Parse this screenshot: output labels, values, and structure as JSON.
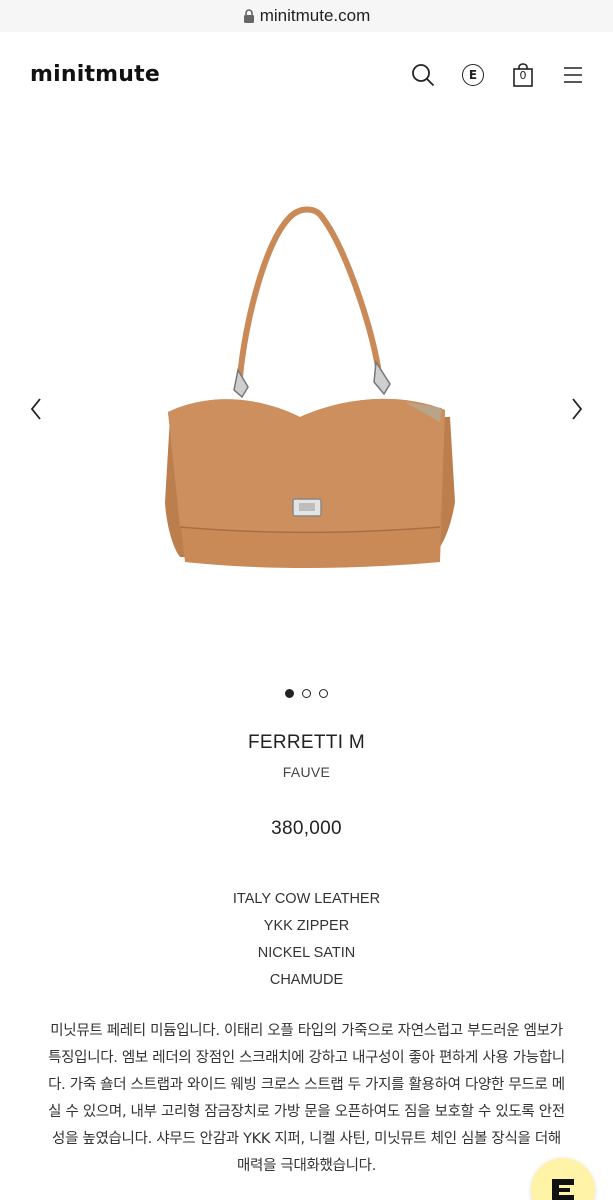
{
  "browser": {
    "url": "minitmute.com"
  },
  "header": {
    "logo": "minitmute",
    "e_badge": "E",
    "cart_count": "0"
  },
  "icons": [
    "lock-icon",
    "search-icon",
    "e-point-icon",
    "shopping-bag-icon",
    "hamburger-menu-icon",
    "chevron-left-icon",
    "chevron-right-icon",
    "chat-icon"
  ],
  "carousel": {
    "slides": 3,
    "active_index": 0
  },
  "product": {
    "name": "FERRETTI M",
    "color": "FAUVE",
    "price": "380,000",
    "specs": [
      "ITALY COW LEATHER",
      "YKK ZIPPER",
      "NICKEL SATIN",
      "CHAMUDE"
    ],
    "description": "미닛뮤트 페레티 미듐입니다. 이태리 오플 타입의 가죽으로 자연스럽고 부드러운 엠보가 특징입니다. 엠보 레더의 장점인 스크래치에 강하고 내구성이 좋아 편하게 사용 가능합니다. 가죽 숄더 스트랩과 와이드 웨빙 크로스 스트랩 두 가지를 활용하여 다양한 무드로 메실 수 있으며, 내부 고리형 잠금장치로 가방 문을 오픈하여도 짐을 보호할 수 있도록 안전성을 높였습니다. 샤무드 안감과 YKK 지퍼, 니켈 사틴, 미닛뮤트 체인 심볼 장식을 더해 매력을 극대화했습니다."
  },
  "colors": {
    "bag_leather": "#c98a58",
    "fab_background": "#fff3a8"
  }
}
